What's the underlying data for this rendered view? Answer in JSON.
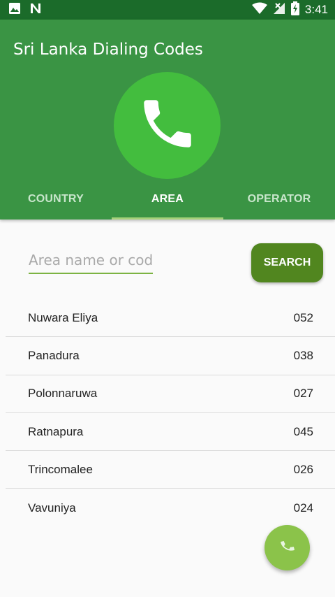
{
  "status_bar": {
    "time": "3:41",
    "icons": [
      "image-icon",
      "n-notification-icon",
      "wifi-icon",
      "signal-off-icon",
      "battery-charging-icon"
    ]
  },
  "app_bar": {
    "title": "Sri Lanka Dialing Codes",
    "hero_icon": "phone-icon",
    "colors": {
      "app_bar": "#3a9444",
      "status_bar": "#1b6b2a",
      "hero_circle": "#43bd3e",
      "accent": "#8bc34a"
    }
  },
  "tabs": [
    {
      "label": "COUNTRY",
      "active": false
    },
    {
      "label": "AREA",
      "active": true
    },
    {
      "label": "OPERATOR",
      "active": false
    }
  ],
  "search": {
    "placeholder": "Area name or code",
    "value": "",
    "button_label": "SEARCH",
    "button_color": "#51861f"
  },
  "areas": [
    {
      "name": "Nuwara Eliya",
      "code": "052"
    },
    {
      "name": "Panadura",
      "code": "038"
    },
    {
      "name": "Polonnaruwa",
      "code": "027"
    },
    {
      "name": "Ratnapura",
      "code": "045"
    },
    {
      "name": "Trincomalee",
      "code": "026"
    },
    {
      "name": "Vavuniya",
      "code": "024"
    }
  ],
  "fab": {
    "icon": "phone-icon"
  }
}
